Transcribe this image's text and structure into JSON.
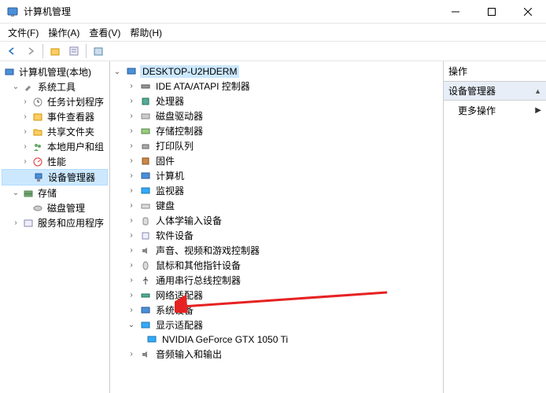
{
  "titlebar": {
    "title": "计算机管理"
  },
  "menubar": {
    "file": "文件(F)",
    "action": "操作(A)",
    "view": "查看(V)",
    "help": "帮助(H)"
  },
  "left_tree": {
    "root": "计算机管理(本地)",
    "system_tools": "系统工具",
    "task_scheduler": "任务计划程序",
    "event_viewer": "事件查看器",
    "shared_folders": "共享文件夹",
    "local_users": "本地用户和组",
    "performance": "性能",
    "device_manager": "设备管理器",
    "storage": "存储",
    "disk_management": "磁盘管理",
    "services": "服务和应用程序"
  },
  "devices": {
    "root": "DESKTOP-U2HDERM",
    "ide": "IDE ATA/ATAPI 控制器",
    "cpu": "处理器",
    "disk": "磁盘驱动器",
    "storage_ctrl": "存储控制器",
    "print": "打印队列",
    "firmware": "固件",
    "computer": "计算机",
    "monitor": "监视器",
    "keyboard": "键盘",
    "hid": "人体学输入设备",
    "software": "软件设备",
    "audio_video": "声音、视频和游戏控制器",
    "mouse": "鼠标和其他指针设备",
    "usb": "通用串行总线控制器",
    "network": "网络适配器",
    "system": "系统设备",
    "display": "显示适配器",
    "gpu": "NVIDIA GeForce GTX 1050 Ti",
    "audio_io": "音频输入和输出"
  },
  "right": {
    "header": "操作",
    "section": "设备管理器",
    "more": "更多操作"
  }
}
